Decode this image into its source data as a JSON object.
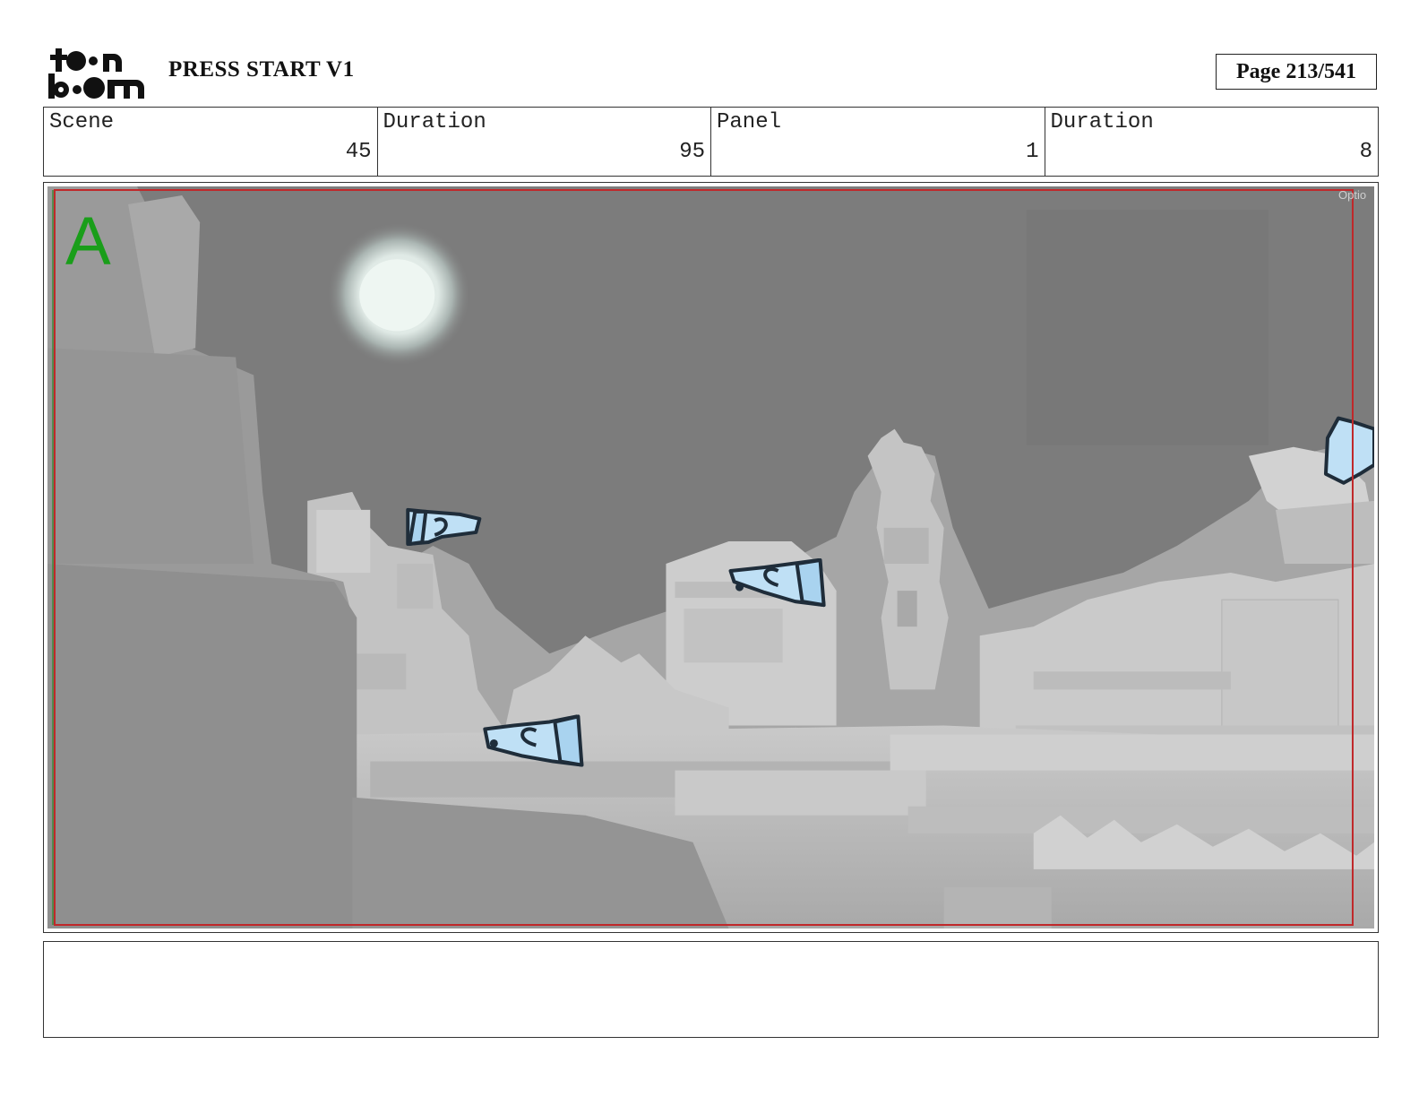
{
  "header": {
    "project_title": "PRESS START V1",
    "page_label": "Page 213/541"
  },
  "logo": {
    "line1": "toon",
    "line2": "boom"
  },
  "info": [
    {
      "label": "Scene",
      "value": "45"
    },
    {
      "label": "Duration",
      "value": "95"
    },
    {
      "label": "Panel",
      "value": "1"
    },
    {
      "label": "Duration",
      "value": "8"
    }
  ],
  "panel": {
    "letter": "A",
    "option_label": "Optio"
  },
  "notes": {
    "text": ""
  },
  "colors": {
    "sky": "#7d7d7d",
    "moon": "#e8f2ee",
    "safe_frame": "#c0282a",
    "panel_letter": "#1a9e1a",
    "character_fill": "#bfe0f5",
    "character_stroke": "#1f2d3a"
  }
}
